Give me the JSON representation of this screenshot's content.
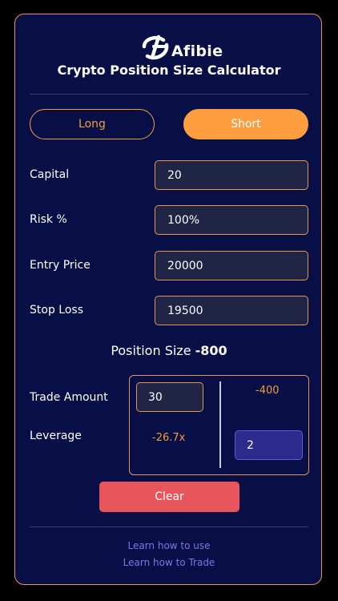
{
  "app": {
    "logo_text": "Afibie",
    "title": "Crypto Position Size Calculator"
  },
  "toggle": {
    "long_label": "Long",
    "short_label": "Short",
    "selected": "Short"
  },
  "fields": [
    {
      "label": "Capital",
      "value": "20"
    },
    {
      "label": "Risk %",
      "value": "100%"
    },
    {
      "label": "Entry Price",
      "value": "20000"
    },
    {
      "label": "Stop Loss",
      "value": "19500"
    }
  ],
  "result": {
    "label": "Position Size",
    "value": "-800"
  },
  "trade": {
    "trade_amount_label": "Trade Amount",
    "trade_amount_value": "30",
    "trade_amount_result": "-400",
    "leverage_label": "Leverage",
    "leverage_result": "-26.7x",
    "leverage_value": "2"
  },
  "clear_label": "Clear",
  "links": {
    "learn_use": "Learn how to use",
    "learn_trade": "Learn how to Trade"
  },
  "colors": {
    "background": "#080f46",
    "accent": "#fe9e3f",
    "clear": "#e8555b",
    "link": "#7a78e6"
  }
}
